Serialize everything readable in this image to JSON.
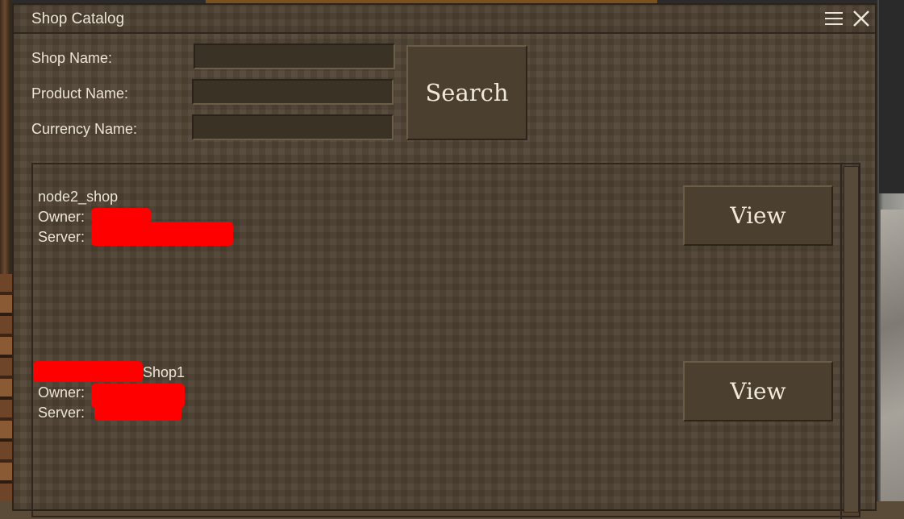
{
  "window": {
    "title": "Shop Catalog",
    "menu_icon": "hamburger-menu-icon",
    "close_icon": "close-icon"
  },
  "search_form": {
    "shop_name_label": "Shop Name:",
    "shop_name_value": "",
    "product_name_label": "Product Name:",
    "product_name_value": "",
    "currency_name_label": "Currency Name:",
    "currency_name_value": "",
    "search_label": "Search"
  },
  "shops": [
    {
      "name": "node2_shop",
      "owner_label": "Owner:",
      "server_label": "Server:",
      "view_label": "View"
    },
    {
      "name_suffix": "Shop1",
      "owner_label": "Owner:",
      "server_label": "Server:",
      "view_label": "View"
    }
  ],
  "colors": {
    "panel": "#4f4333",
    "text": "#ece4d6",
    "redaction": "#ff0000"
  }
}
